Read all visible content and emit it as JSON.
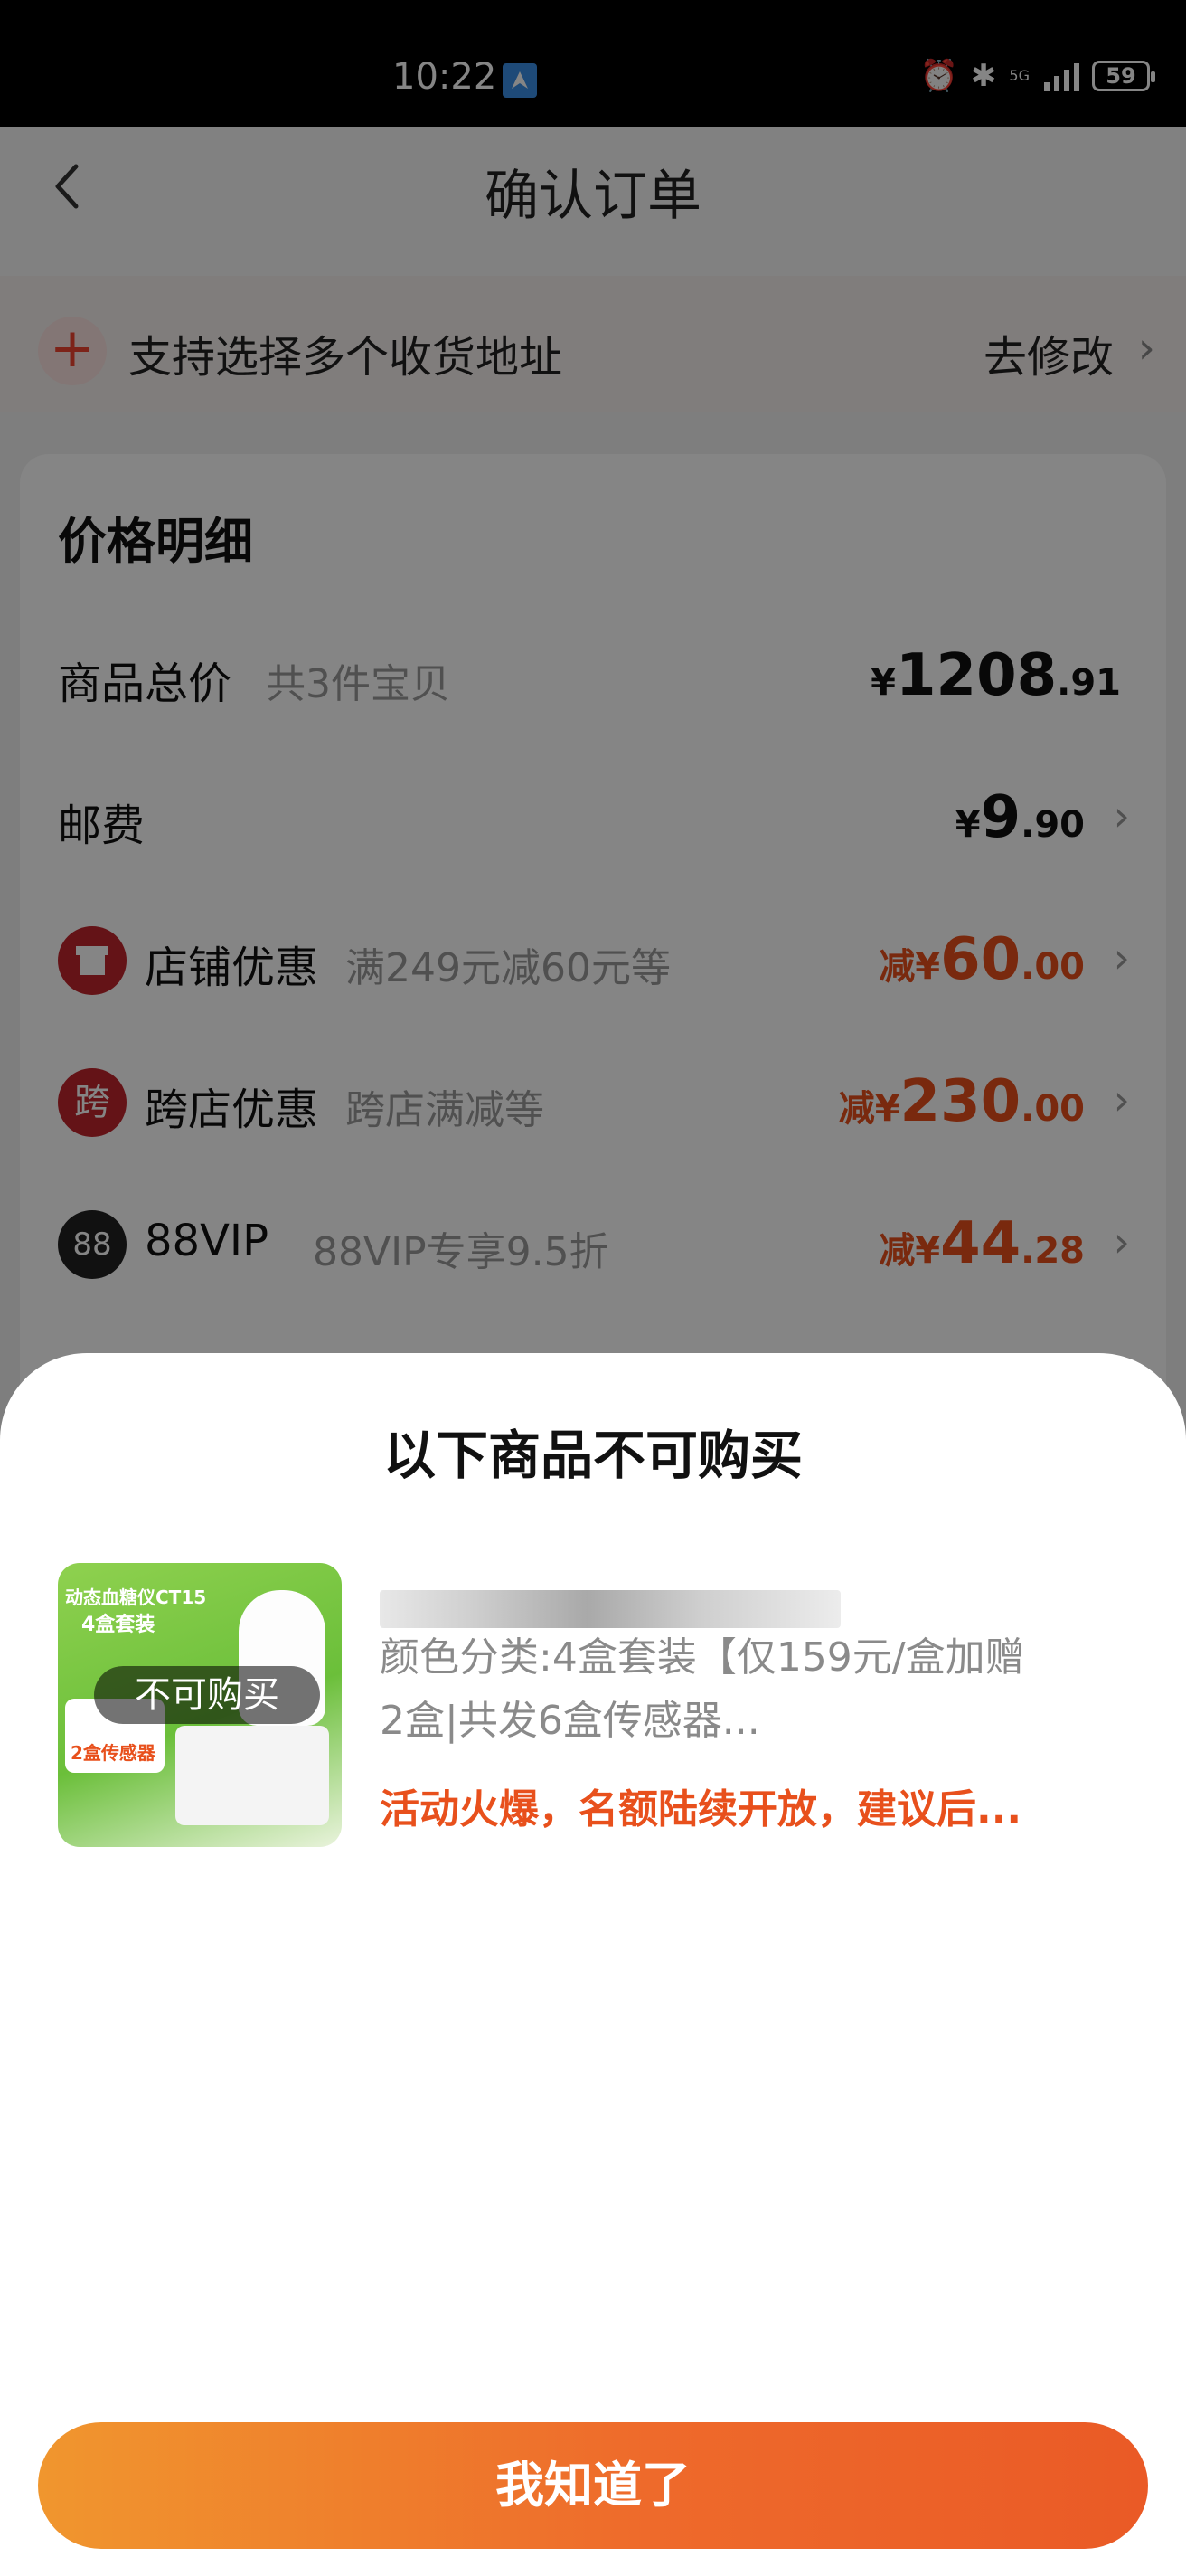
{
  "status_bar": {
    "time": "10:22",
    "network": "5G",
    "battery": "59"
  },
  "nav": {
    "title": "确认订单"
  },
  "address_bar": {
    "label": "支持选择多个收货地址",
    "action": "去修改"
  },
  "price_detail": {
    "heading": "价格明细",
    "rows": [
      {
        "label": "商品总价",
        "sub": "共3件宝贝",
        "prefix": "",
        "currency": "¥",
        "int": "1208",
        "dec": ".91"
      },
      {
        "label": "邮费",
        "sub": "",
        "prefix": "",
        "currency": "¥",
        "int": "9",
        "dec": ".90"
      },
      {
        "label": "店铺优惠",
        "sub": "满249元减60元等",
        "prefix": "减",
        "currency": "¥",
        "int": "60",
        "dec": ".00",
        "badge": "",
        "badge_color": "#c0262c"
      },
      {
        "label": "跨店优惠",
        "sub": "跨店满减等",
        "prefix": "减",
        "currency": "¥",
        "int": "230",
        "dec": ".00",
        "badge": "跨",
        "badge_color": "#c0262c"
      },
      {
        "label": "88VIP",
        "sub": "88VIP专享9.5折",
        "prefix": "减",
        "currency": "¥",
        "int": "44",
        "dec": ".28",
        "badge": "88",
        "badge_color": "#222222"
      }
    ]
  },
  "sheet": {
    "title": "以下商品不可购买",
    "product": {
      "thumb_title": "动态血糖仪CT15",
      "thumb_subtitle": "4盒套装",
      "thumb_badge": "2盒传感器",
      "unavailable_label": "不可购买",
      "spec": "颜色分类:4盒套装【仅159元/盒加赠2盒|共发6盒传感器...",
      "warning": "活动火爆，名额陆续开放，建议后..."
    },
    "confirm_button": "我知道了"
  },
  "colors": {
    "accent_red": "#e8501c",
    "button_gradient_start": "#f0962e",
    "button_gradient_end": "#ea5a26"
  }
}
